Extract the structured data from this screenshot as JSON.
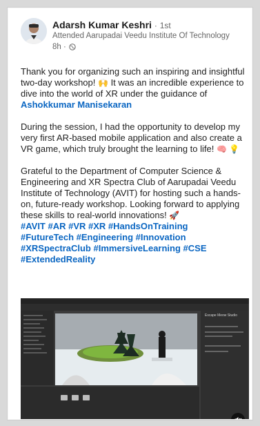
{
  "author": {
    "name": "Adarsh Kumar Keshri",
    "separator": "·",
    "degree": "1st",
    "headline": "Attended Aarupadai Veedu Institute Of Technology",
    "time": "8h ·"
  },
  "post": {
    "p1_before": "Thank you for organizing such an inspiring and insightful two-day workshop! ",
    "p1_emoji": "🙌",
    "p1_after": " It was an incredible experience to dive into the world of XR under the guidance of ",
    "mention": "Ashokkumar Manisekaran",
    "p2_text": "During the session, I had the opportunity to develop my very first AR-based mobile application and also create a VR game, which truly brought the learning to life! ",
    "p2_emojis": "🧠 💡",
    "p3_text": "Grateful to the Department of Computer Science & Engineering and XR Spectra Club of Aarupadai Veedu Institute of Technology (AVIT) for hosting such a hands-on, future-ready workshop. Looking forward to applying these skills to real-world innovations! ",
    "p3_emoji": "🚀",
    "hashtags_line1": "#AVIT #AR #VR #XR #HandsOnTraining",
    "hashtags_line2": "#FutureTech #Engineering #Innovation",
    "hashtags_line3": "#XRSpectraClub #ImmersiveLearning #CSE",
    "hashtags_line4": "#ExtendedReality"
  },
  "video": {
    "inspector_title": "Escape Meow Studio",
    "mute_icon": "volume-mute-icon"
  },
  "colors": {
    "link": "#0a66c2",
    "text": "#1f1f1f",
    "muted": "#666666"
  }
}
